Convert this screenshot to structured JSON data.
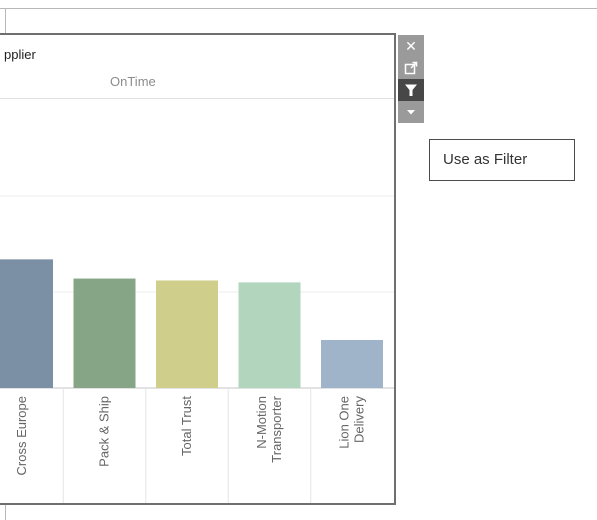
{
  "panel": {
    "title": "pplier",
    "subtitle": "OnTime"
  },
  "toolbar": {
    "close_icon": "close-icon",
    "popout_icon": "popout-icon",
    "filter_icon": "filter-icon",
    "dropdown_icon": "caret-down-icon"
  },
  "tooltip": {
    "text": "Use as Filter"
  },
  "chart_data": {
    "type": "bar",
    "categories": [
      "Cross Europe",
      "Pack & Ship",
      "Total Trust",
      "N-Motion Transporter",
      "Lion One Delivery"
    ],
    "labels": [
      [
        "Cross Europe"
      ],
      [
        "Pack & Ship"
      ],
      [
        "Total Trust"
      ],
      [
        "N-Motion",
        "Transporter"
      ],
      [
        "Lion One",
        "Delivery"
      ]
    ],
    "values": [
      0.67,
      0.57,
      0.56,
      0.55,
      0.25
    ],
    "colors": [
      "#7b8fa5",
      "#86a486",
      "#cfcf8b",
      "#b2d6bd",
      "#9fb4c9"
    ],
    "ylim": [
      0,
      1.5
    ],
    "grid": true,
    "xlabel": "",
    "ylabel": "",
    "title": ""
  }
}
